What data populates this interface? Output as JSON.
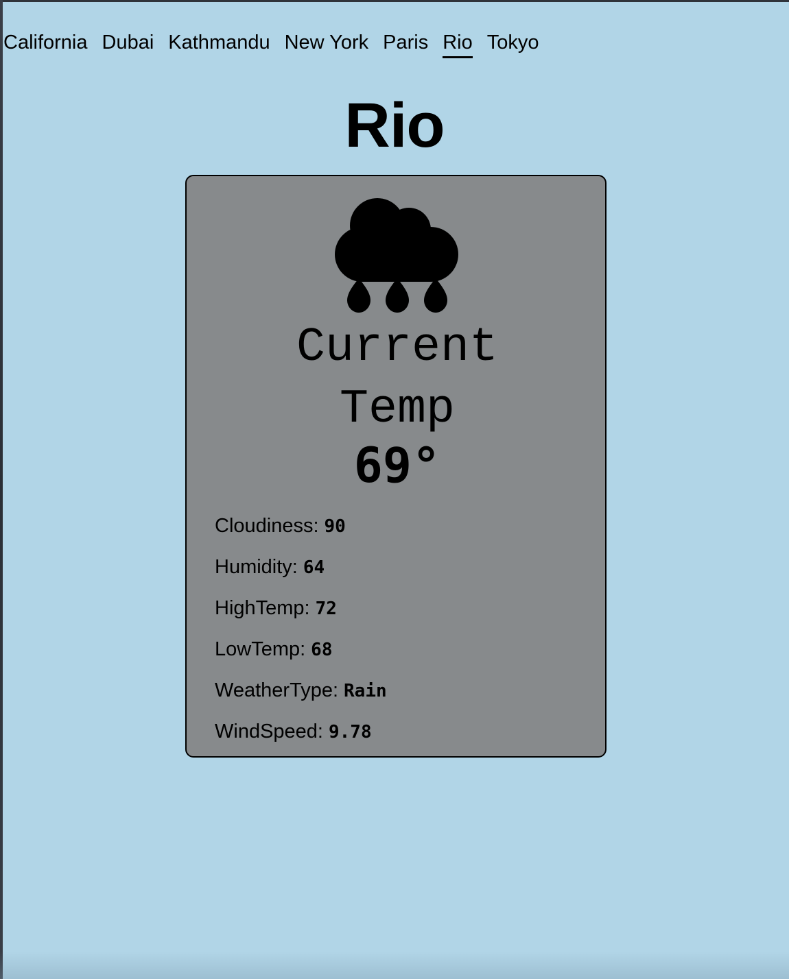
{
  "nav": {
    "cities": [
      {
        "label": "California"
      },
      {
        "label": "Dubai"
      },
      {
        "label": "Kathmandu"
      },
      {
        "label": "New York"
      },
      {
        "label": "Paris"
      },
      {
        "label": "Rio"
      },
      {
        "label": "Tokyo"
      }
    ],
    "active_city": "Rio"
  },
  "page": {
    "title": "Rio",
    "background_color": "#b1d5e7"
  },
  "card": {
    "background_color": "#878a8c",
    "icon": "rain-cloud-icon",
    "current_temp_label": "Current Temp",
    "temperature": "69°",
    "stats": [
      {
        "label": "Cloudiness:",
        "value": "90"
      },
      {
        "label": "Humidity:",
        "value": "64"
      },
      {
        "label": "HighTemp:",
        "value": "72"
      },
      {
        "label": "LowTemp:",
        "value": "68"
      },
      {
        "label": "WeatherType:",
        "value": "Rain"
      },
      {
        "label": "WindSpeed:",
        "value": "9.78"
      }
    ]
  }
}
